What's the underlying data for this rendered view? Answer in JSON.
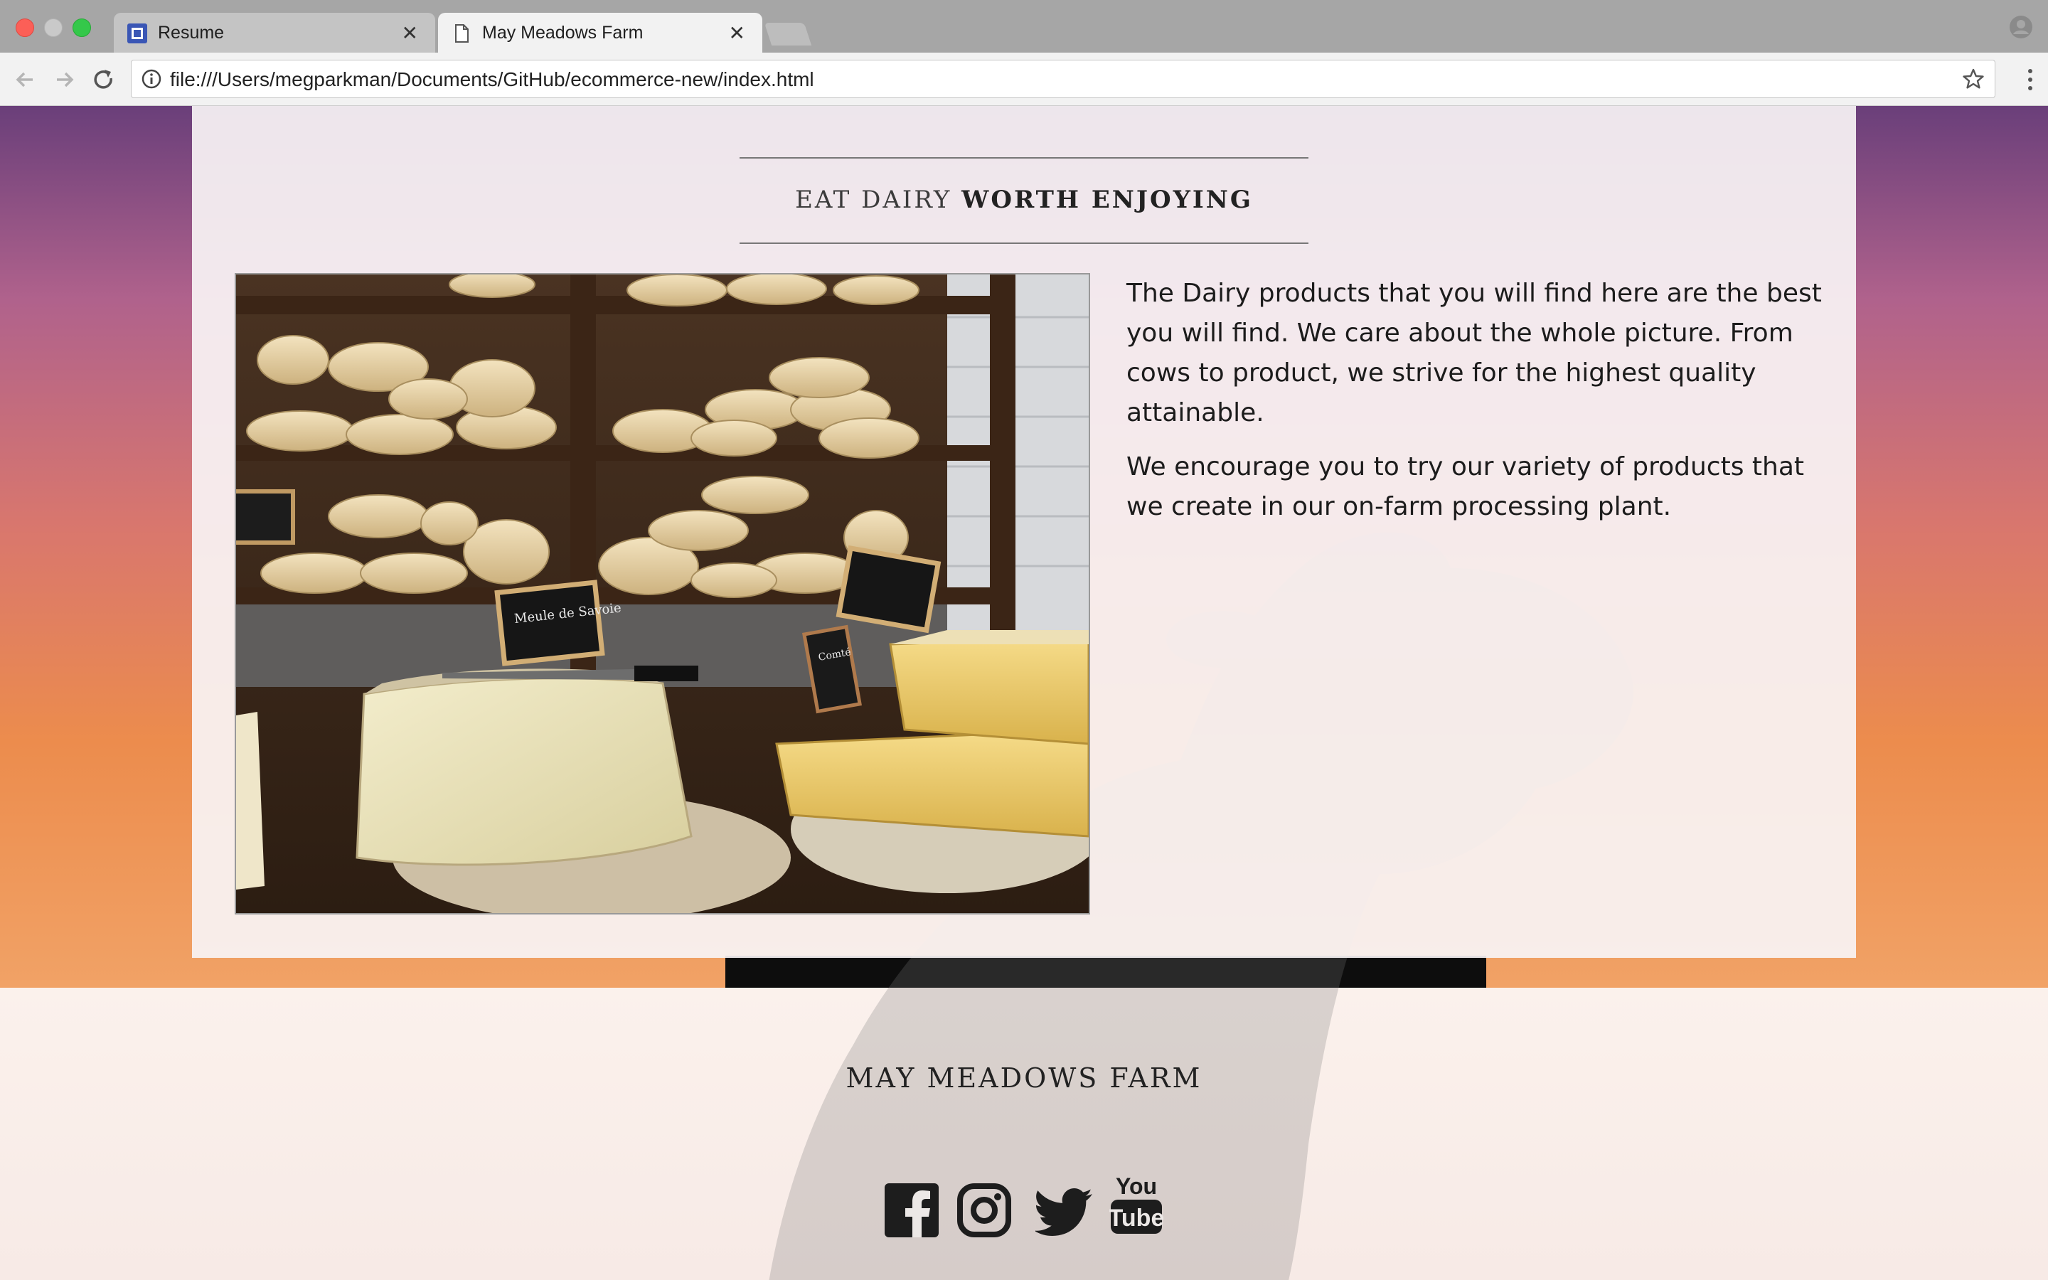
{
  "browser": {
    "tabs": [
      {
        "label": "Resume",
        "active": false
      },
      {
        "label": "May Meadows Farm",
        "active": true
      }
    ],
    "url": "file:///Users/megparkman/Documents/GitHub/ecommerce-new/index.html",
    "colors": {
      "tabbar": "#a6a6a6",
      "toolbar": "#f2f2f2",
      "favicon_resume": "#3a56b5"
    }
  },
  "section": {
    "heading_light": "EAT DAIRY",
    "heading_bold": "WORTH ENJOYING",
    "paragraphs": [
      "The Dairy products that you will find here are the best you will find. We care about the whole picture. From cows to product, we strive for the highest quality attainable.",
      "We encourage you to try our variety of products that we create in our on-farm processing plant."
    ],
    "image": "cheese-shop-photo",
    "image_labels": [
      "Meule de Savoie",
      "Comté"
    ]
  },
  "footer": {
    "title": "MAY MEADOWS FARM",
    "social": [
      {
        "name": "facebook-icon"
      },
      {
        "name": "instagram-icon"
      },
      {
        "name": "twitter-icon"
      },
      {
        "name": "youtube-icon",
        "line1": "You",
        "line2": "Tube"
      }
    ]
  },
  "colors": {
    "sky_top": "#6a3f7a",
    "sky_mid": "#d9776d",
    "sky_bottom": "#f1a266",
    "card": "#f8f4f5",
    "text": "#1c1c1c"
  }
}
